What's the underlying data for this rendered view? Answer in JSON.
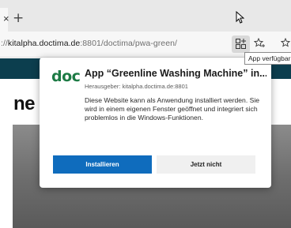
{
  "browser": {
    "tab": {
      "close_glyph": "×"
    },
    "new_tab_glyph": "+",
    "url_prefix": "://",
    "url_host": "kitalpha.doctima.de",
    "url_path": ":8801/doctima/pwa-green/",
    "toolbar_icons": [
      "app-available-icon",
      "add-favorite-icon",
      "favorites-star-icon"
    ],
    "tooltip": "App verfügbar"
  },
  "page": {
    "heading_fragment": "ne"
  },
  "dialog": {
    "logo": "doc",
    "title": "App “Greenline Washing Machine” in...",
    "publisher": "Herausgeber: kitalpha.doctima.de:8801",
    "description": "Diese Website kann als Anwendung installiert werden. Sie wird in einem eigenen Fenster geöffnet und integriert sich problemlos in die Windows-Funktionen.",
    "install_label": "Installieren",
    "cancel_label": "Jetzt nicht"
  },
  "colors": {
    "logo_green": "#1d7b45",
    "install_blue": "#0f6cbd",
    "site_header": "#0c3e4e"
  }
}
